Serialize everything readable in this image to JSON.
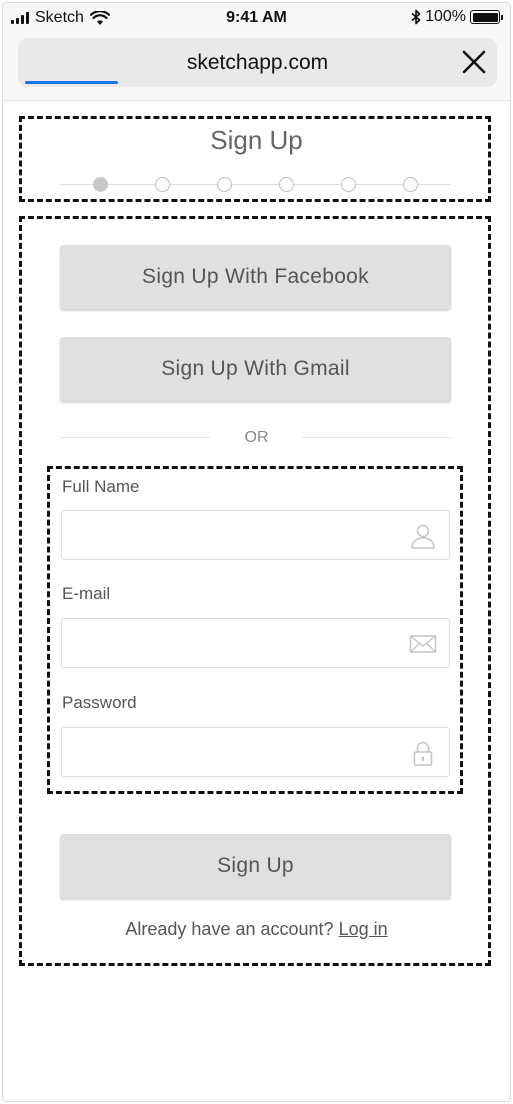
{
  "status_bar": {
    "carrier": "Sketch",
    "time": "9:41 AM",
    "battery": "100%"
  },
  "browser": {
    "url": "sketchapp.com",
    "load_progress": 0.2
  },
  "page": {
    "title": "Sign Up",
    "steps": {
      "count": 6,
      "current": 1
    }
  },
  "social": {
    "facebook_label": "Sign Up With Facebook",
    "gmail_label": "Sign Up With Gmail"
  },
  "divider": {
    "label": "OR"
  },
  "form": {
    "full_name": {
      "label": "Full Name",
      "value": "",
      "placeholder": "",
      "icon": "user-icon"
    },
    "email": {
      "label": "E-mail",
      "value": "",
      "placeholder": "",
      "icon": "envelope-icon"
    },
    "password": {
      "label": "Password",
      "value": "",
      "placeholder": "",
      "icon": "lock-icon"
    }
  },
  "actions": {
    "submit_label": "Sign Up",
    "login_prompt": "Already have an account?",
    "login_link": "Log in"
  },
  "colors": {
    "button_bg": "#e0e0e0",
    "progress": "#1a73e8",
    "dashed_border": "#111111"
  }
}
